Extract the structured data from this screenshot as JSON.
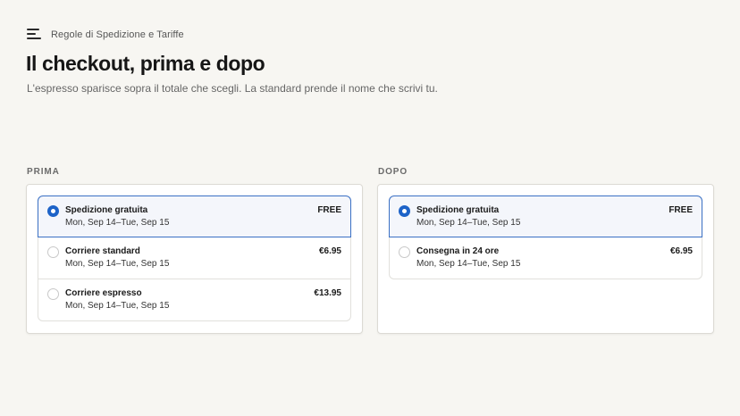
{
  "header": {
    "logo_icon": "stacked-lines-logo-icon",
    "brand_name": "Regole di Spedizione e Tariffe",
    "title": "Il checkout, prima e dopo",
    "subtitle": "L'espresso sparisce sopra il totale che scegli. La standard prende il nome che scrivi tu."
  },
  "before": {
    "label": "PRIMA",
    "options": [
      {
        "name": "Spedizione gratuita",
        "date": "Mon, Sep 14–Tue, Sep 15",
        "price": "FREE",
        "selected": true
      },
      {
        "name": "Corriere standard",
        "date": "Mon, Sep 14–Tue, Sep 15",
        "price": "€6.95",
        "selected": false
      },
      {
        "name": "Corriere espresso",
        "date": "Mon, Sep 14–Tue, Sep 15",
        "price": "€13.95",
        "selected": false
      }
    ]
  },
  "after": {
    "label": "DOPO",
    "options": [
      {
        "name": "Spedizione gratuita",
        "date": "Mon, Sep 14–Tue, Sep 15",
        "price": "FREE",
        "selected": true
      },
      {
        "name": "Consegna in 24 ore",
        "date": "Mon, Sep 14–Tue, Sep 15",
        "price": "€6.95",
        "selected": false
      }
    ]
  },
  "colors": {
    "background": "#f7f6f2",
    "accent": "#1d63c8",
    "selected_bg": "#f4f6fb"
  }
}
